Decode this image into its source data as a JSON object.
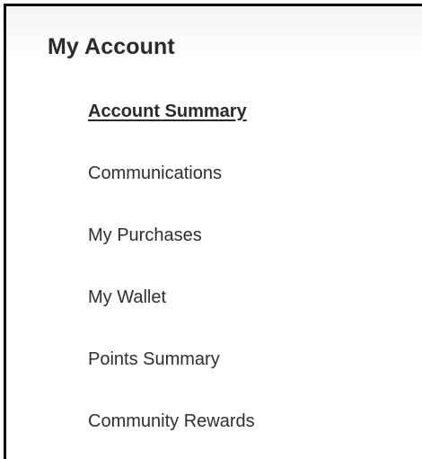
{
  "account_nav": {
    "title": "My Account",
    "items": [
      {
        "label": "Account Summary",
        "active": true
      },
      {
        "label": "Communications",
        "active": false
      },
      {
        "label": "My Purchases",
        "active": false
      },
      {
        "label": "My Wallet",
        "active": false
      },
      {
        "label": "Points Summary",
        "active": false
      },
      {
        "label": "Community Rewards",
        "active": false
      }
    ]
  }
}
